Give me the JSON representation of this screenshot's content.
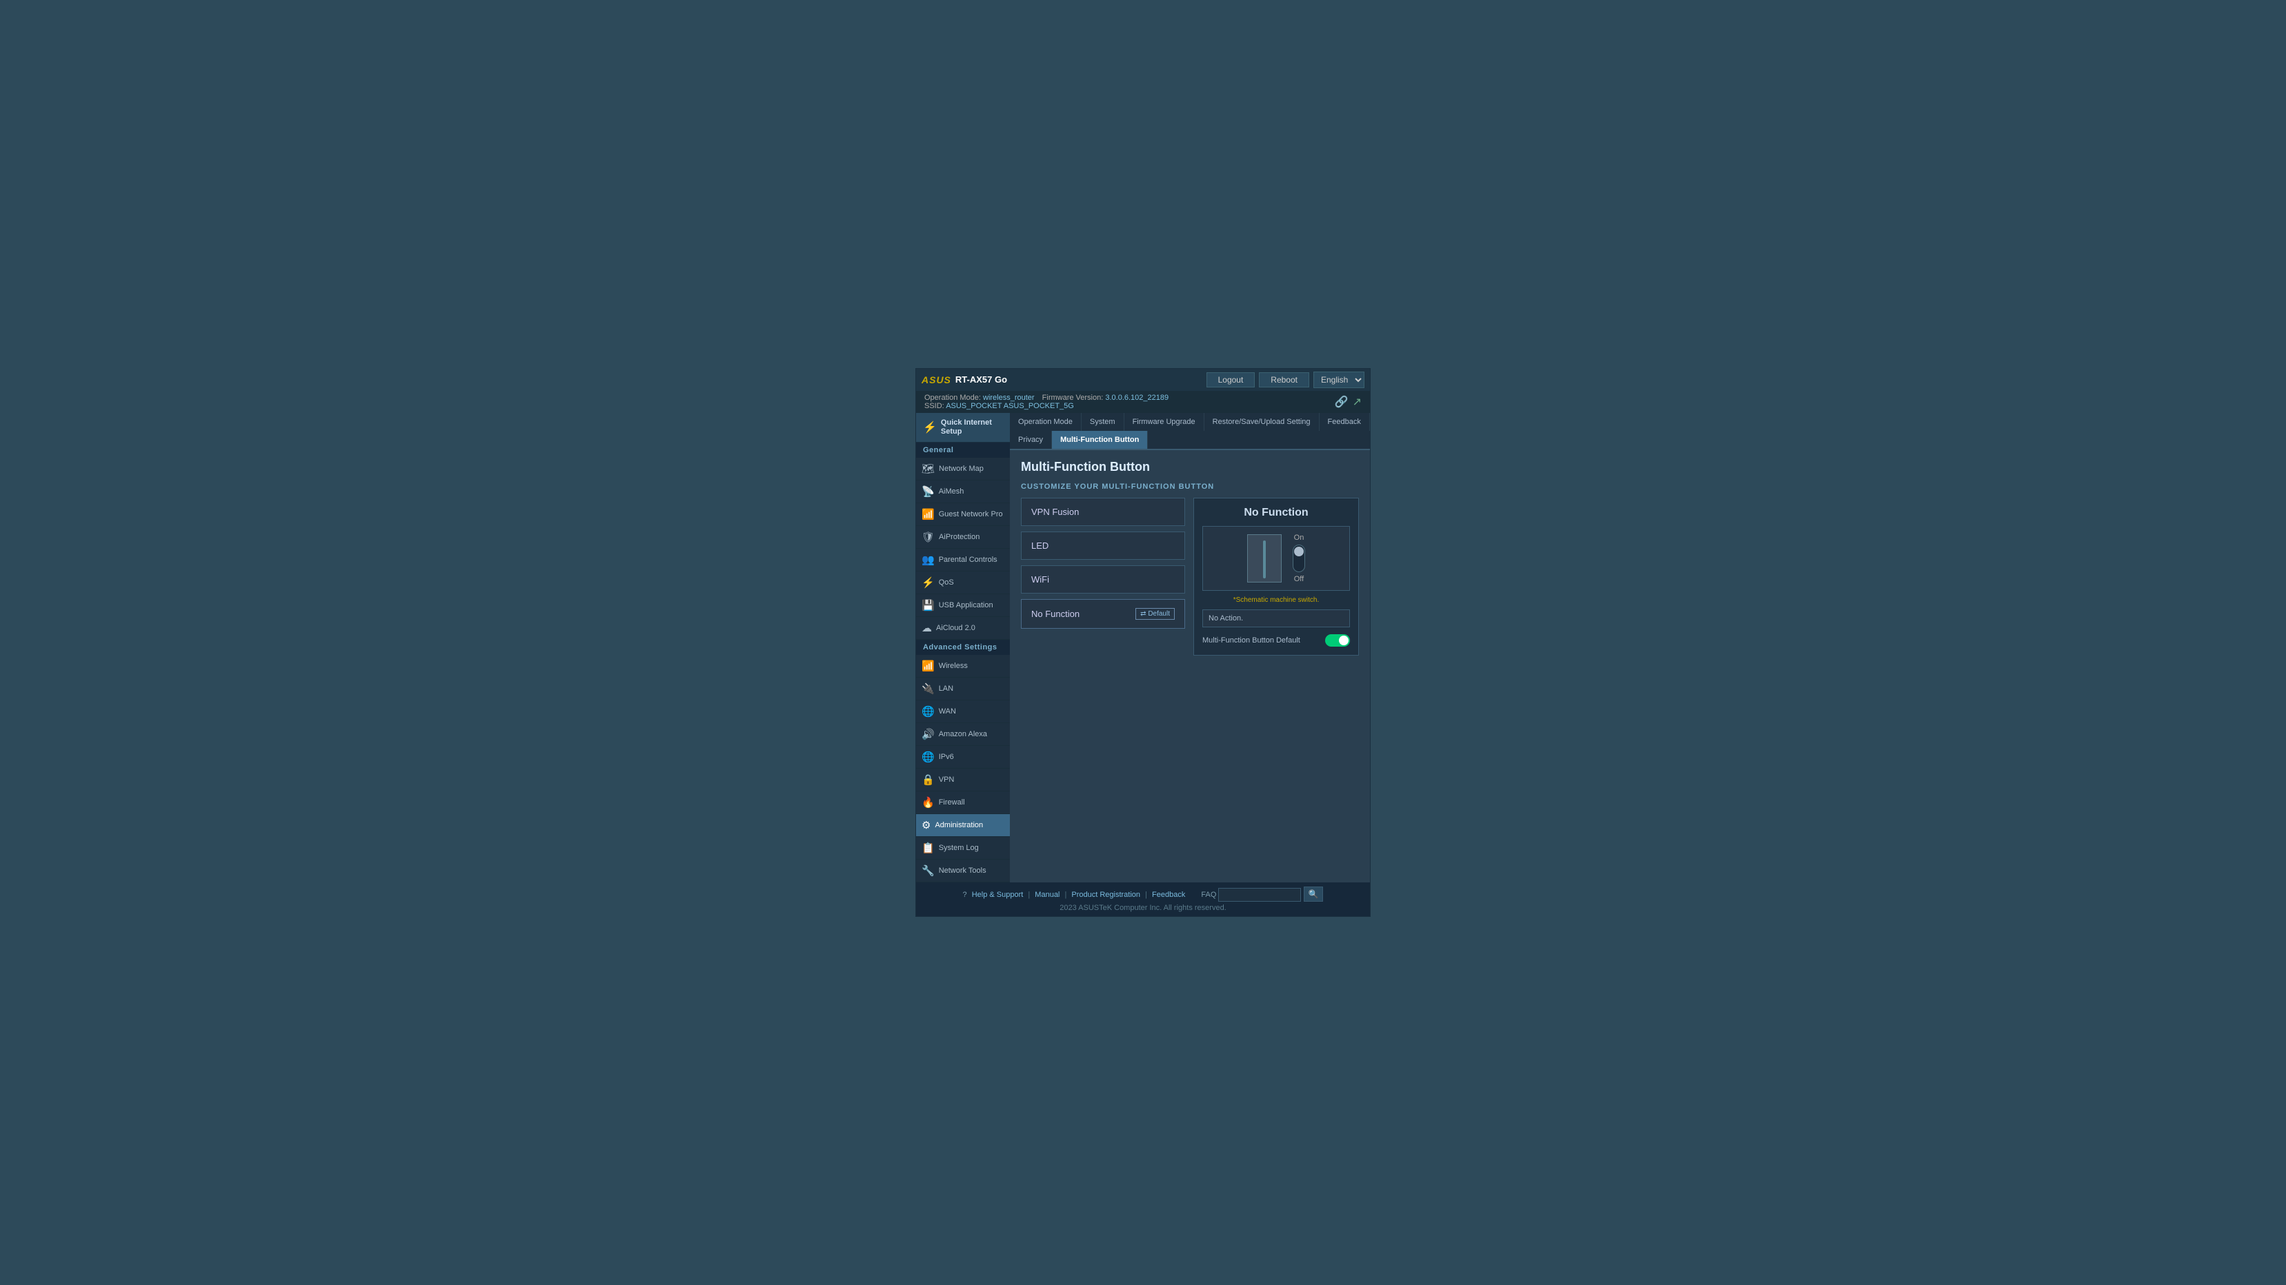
{
  "topbar": {
    "logo": "ASUS",
    "model": "RT-AX57 Go",
    "logout_label": "Logout",
    "reboot_label": "Reboot",
    "language": "English"
  },
  "infobar": {
    "operation_mode_label": "Operation Mode:",
    "operation_mode_value": "wireless_router",
    "firmware_label": "Firmware Version:",
    "firmware_value": "3.0.0.6.102_22189",
    "ssid_label": "SSID:",
    "ssid_value": "ASUS_POCKET  ASUS_POCKET_5G"
  },
  "sidebar": {
    "quick_setup_label": "Quick Internet Setup",
    "general_label": "General",
    "advanced_label": "Advanced Settings",
    "nav_items_general": [
      {
        "id": "network-map",
        "label": "Network Map",
        "icon": "🗺"
      },
      {
        "id": "aimesh",
        "label": "AiMesh",
        "icon": "📡"
      },
      {
        "id": "guest-network",
        "label": "Guest Network Pro",
        "icon": "📶"
      },
      {
        "id": "aiprotection",
        "label": "AiProtection",
        "icon": "🛡"
      },
      {
        "id": "parental-controls",
        "label": "Parental Controls",
        "icon": "👥"
      },
      {
        "id": "qos",
        "label": "QoS",
        "icon": "⚡"
      },
      {
        "id": "usb-application",
        "label": "USB Application",
        "icon": "💾"
      },
      {
        "id": "aicloud",
        "label": "AiCloud 2.0",
        "icon": "☁"
      }
    ],
    "nav_items_advanced": [
      {
        "id": "wireless",
        "label": "Wireless",
        "icon": "📶"
      },
      {
        "id": "lan",
        "label": "LAN",
        "icon": "🔌"
      },
      {
        "id": "wan",
        "label": "WAN",
        "icon": "🌐"
      },
      {
        "id": "amazon-alexa",
        "label": "Amazon Alexa",
        "icon": "🔊"
      },
      {
        "id": "ipv6",
        "label": "IPv6",
        "icon": "🌐"
      },
      {
        "id": "vpn",
        "label": "VPN",
        "icon": "🔒"
      },
      {
        "id": "firewall",
        "label": "Firewall",
        "icon": "🔥"
      },
      {
        "id": "administration",
        "label": "Administration",
        "icon": "⚙",
        "active": true
      },
      {
        "id": "system-log",
        "label": "System Log",
        "icon": "📋"
      },
      {
        "id": "network-tools",
        "label": "Network Tools",
        "icon": "🔧"
      }
    ]
  },
  "tabs": [
    {
      "id": "operation-mode",
      "label": "Operation Mode"
    },
    {
      "id": "system",
      "label": "System"
    },
    {
      "id": "firmware-upgrade",
      "label": "Firmware Upgrade"
    },
    {
      "id": "restore-save",
      "label": "Restore/Save/Upload Setting"
    },
    {
      "id": "feedback",
      "label": "Feedback"
    },
    {
      "id": "privacy",
      "label": "Privacy"
    },
    {
      "id": "multi-function",
      "label": "Multi-Function Button",
      "active": true
    }
  ],
  "page": {
    "title": "Multi-Function Button",
    "customize_label": "CUSTOMIZE YOUR MULTI-FUNCTION BUTTON",
    "functions": [
      {
        "id": "vpn-fusion",
        "label": "VPN Fusion"
      },
      {
        "id": "led",
        "label": "LED"
      },
      {
        "id": "wifi",
        "label": "WiFi"
      },
      {
        "id": "no-function",
        "label": "No Function",
        "is_default": true
      }
    ],
    "default_badge": "⇄ Default",
    "right_panel": {
      "title": "No Function",
      "switch_on_label": "On",
      "switch_off_label": "Off",
      "schematic_note": "*Schematic machine switch.",
      "no_action_label": "No Action.",
      "default_row_label": "Multi-Function Button Default",
      "default_toggle_state": "on"
    }
  },
  "footer": {
    "help_icon": "?",
    "help_label": "Help & Support",
    "manual_label": "Manual",
    "product_reg_label": "Product Registration",
    "feedback_label": "Feedback",
    "faq_label": "FAQ",
    "faq_placeholder": "",
    "search_icon": "🔍",
    "copyright": "2023 ASUSTeK Computer Inc. All rights reserved."
  }
}
